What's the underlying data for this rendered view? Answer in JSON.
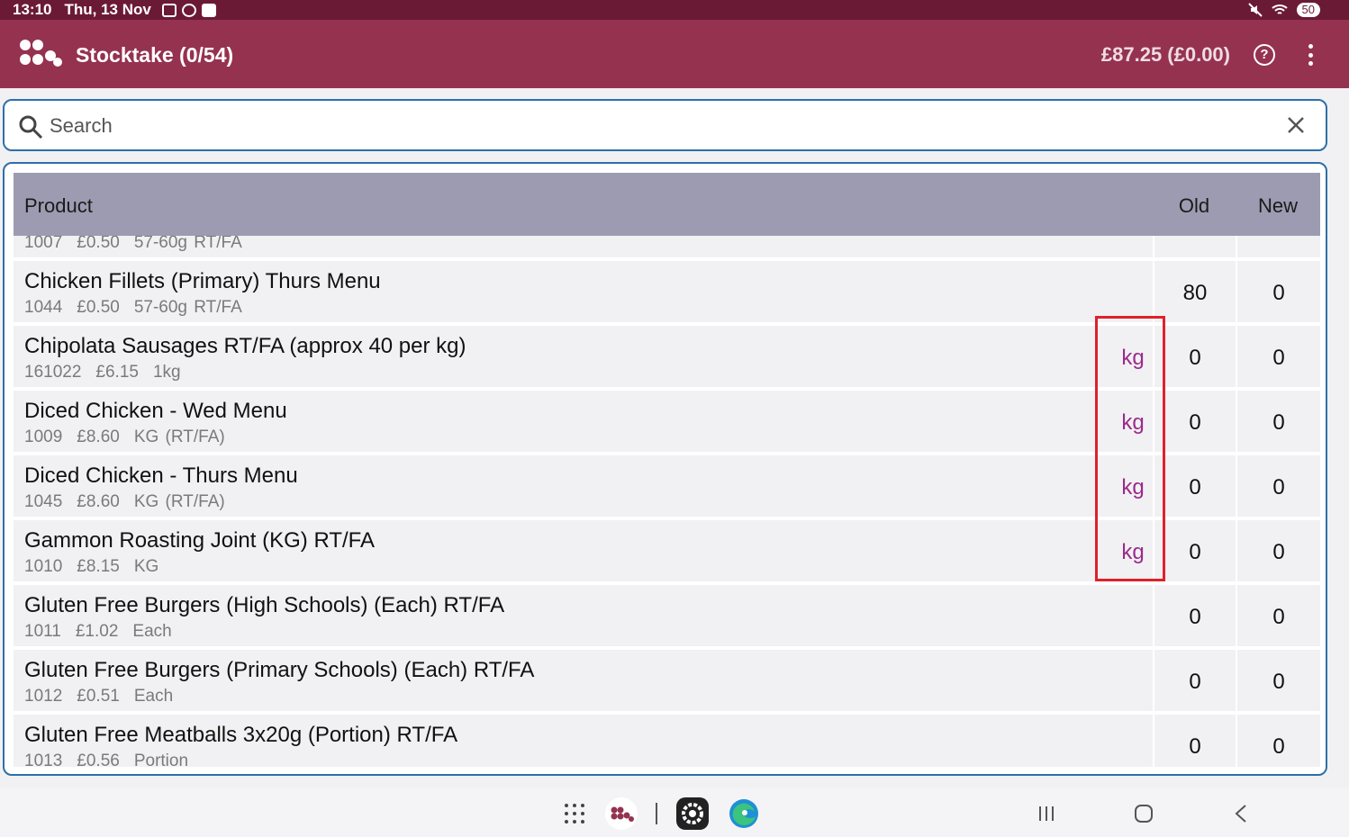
{
  "status_bar": {
    "time": "13:10",
    "date": "Thu, 13 Nov",
    "battery": "50"
  },
  "app_bar": {
    "title": "Stocktake (0/54)",
    "total": "£87.25 (£0.00)",
    "help_icon": "question-circle-icon",
    "menu_icon": "more-vert-icon"
  },
  "search": {
    "placeholder": "Search",
    "value": ""
  },
  "table": {
    "headers": {
      "product": "Product",
      "old": "Old",
      "new": "New"
    },
    "partial_row": {
      "code": "1007",
      "price": "£0.50",
      "pack": "57-60g RT/FA"
    },
    "rows": [
      {
        "name": "Chicken Fillets (Primary) Thurs Menu",
        "code": "1044",
        "price": "£0.50",
        "pack": "57-60g RT/FA",
        "unit": "",
        "old": "80",
        "new": "0"
      },
      {
        "name": "Chipolata Sausages RT/FA (approx 40 per kg)",
        "code": "161022",
        "price": "£6.15",
        "pack": "1kg",
        "unit": "kg",
        "old": "0",
        "new": "0"
      },
      {
        "name": "Diced Chicken -  Wed Menu",
        "code": "1009",
        "price": "£8.60",
        "pack": "KG (RT/FA)",
        "unit": "kg",
        "old": "0",
        "new": "0"
      },
      {
        "name": "Diced Chicken - Thurs Menu",
        "code": "1045",
        "price": "£8.60",
        "pack": "KG (RT/FA)",
        "unit": "kg",
        "old": "0",
        "new": "0"
      },
      {
        "name": "Gammon Roasting Joint (KG) RT/FA",
        "code": "1010",
        "price": "£8.15",
        "pack": "KG",
        "unit": "kg",
        "old": "0",
        "new": "0"
      },
      {
        "name": "Gluten Free Burgers (High Schools) (Each) RT/FA",
        "code": "1011",
        "price": "£1.02",
        "pack": "Each",
        "unit": "",
        "old": "0",
        "new": "0"
      },
      {
        "name": "Gluten Free Burgers (Primary Schools) (Each) RT/FA",
        "code": "1012",
        "price": "£0.51",
        "pack": "Each",
        "unit": "",
        "old": "0",
        "new": "0"
      },
      {
        "name": "Gluten Free Meatballs 3x20g (Portion) RT/FA",
        "code": "1013",
        "price": "£0.56",
        "pack": "Portion",
        "unit": "",
        "old": "0",
        "new": "0"
      }
    ]
  },
  "colors": {
    "app_bar": "#953250",
    "status_bar": "#6b1a35",
    "header": "#9d9bb1",
    "unit": "#9c2a8c",
    "highlight": "#e0202a"
  }
}
